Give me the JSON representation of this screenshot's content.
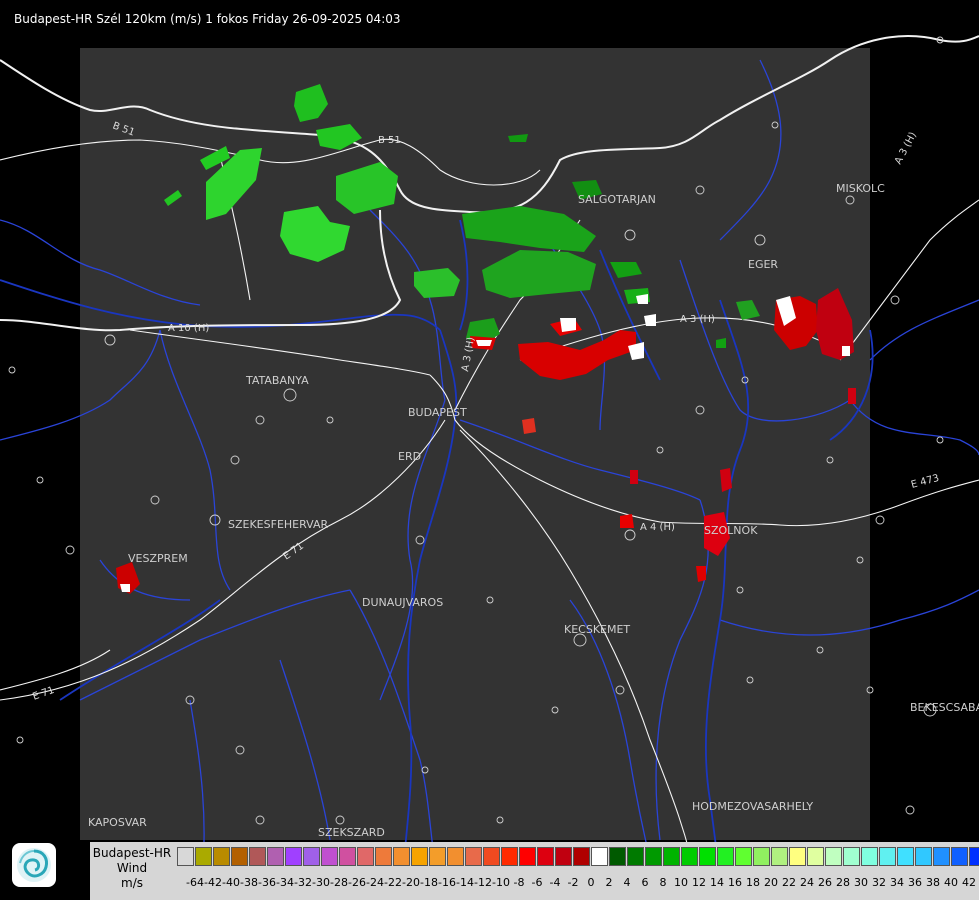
{
  "title": "Budapest-HR Szél 120km (m/s) 1 fokos Friday 26-09-2025 04:03",
  "map": {
    "cities": [
      "TATABANYA",
      "BUDAPEST",
      "ERD",
      "SZEKESFEHERVAR",
      "VESZPREM",
      "DUNAUJVAROS",
      "KECSKEMET",
      "SALGOTARJAN",
      "EGER",
      "MISKOLC",
      "SZOLNOK",
      "BEKESCSABA",
      "HODMEZOVASARHELY",
      "KAPOSVAR",
      "SZEKSZARD"
    ],
    "roads": [
      "B 51",
      "B 51",
      "A 3 (H)",
      "A 3 (H)",
      "A 3 (H)",
      "A 4 (H)",
      "E 71",
      "E 71",
      "E 473",
      "A 10 (H)"
    ],
    "colors": {
      "background": "#000000",
      "radar_area": "#333333",
      "borders": "#ffffff",
      "rivers": "#1f3fd0"
    }
  },
  "legend": {
    "name_line1": "Budapest-HR",
    "name_line2": "Wind",
    "unit": "m/s",
    "colors": [
      "#d8d8d8",
      "#aaaa00",
      "#b98b00",
      "#b36000",
      "#b05858",
      "#b060b0",
      "#a040ff",
      "#a060e8",
      "#c050d0",
      "#d050a0",
      "#e06868",
      "#ee7a3a",
      "#f28f2f",
      "#f6a300",
      "#f39d2a",
      "#f28f2f",
      "#e86a4a",
      "#f04a20",
      "#ff2a00",
      "#ff0000",
      "#dd0010",
      "#c00010",
      "#b00000",
      "#ffffff",
      "#005a00",
      "#007a00",
      "#009a00",
      "#00b400",
      "#00cc00",
      "#00e000",
      "#22f022",
      "#60ff30",
      "#90f060",
      "#b0f080",
      "#ffff80",
      "#e0ffa0",
      "#c0ffc0",
      "#a0ffd0",
      "#80ffe0",
      "#60f0f0",
      "#40e0ff",
      "#30c8ff",
      "#2090ff",
      "#1060ff",
      "#0030ff",
      "#0000ee"
    ],
    "labels": [
      "-64",
      "-42",
      "-40",
      "-38",
      "-36",
      "-34",
      "-32",
      "-30",
      "-28",
      "-26",
      "-24",
      "-22",
      "-20",
      "-18",
      "-16",
      "-14",
      "-12",
      "-10",
      "-8",
      "-6",
      "-4",
      "-2",
      "0",
      "2",
      "4",
      "6",
      "8",
      "10",
      "12",
      "14",
      "16",
      "18",
      "20",
      "22",
      "24",
      "26",
      "28",
      "30",
      "32",
      "34",
      "36",
      "38",
      "40",
      "42"
    ]
  }
}
